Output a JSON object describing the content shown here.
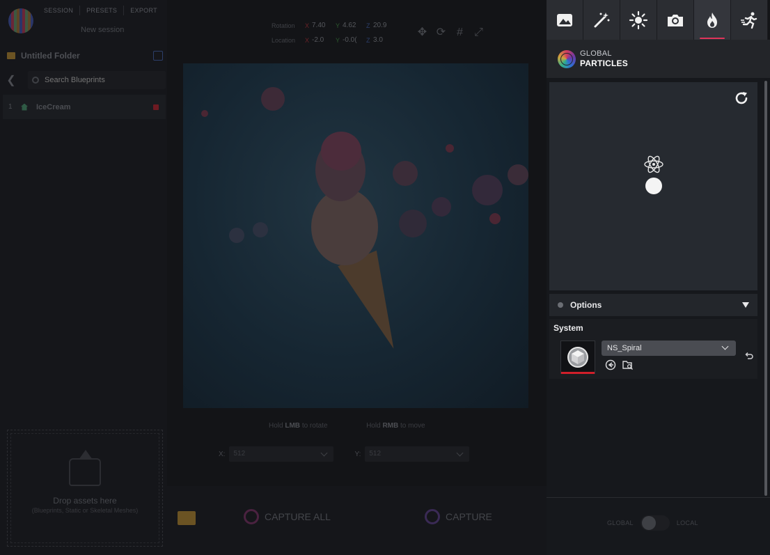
{
  "app": {
    "menu": [
      "SESSION",
      "PRESETS",
      "EXPORT"
    ],
    "session_name": "New session"
  },
  "sidebar": {
    "folder_title": "Untitled Folder",
    "search_placeholder": "Search Blueprints",
    "items": [
      {
        "index": "1",
        "name": "IceCream"
      }
    ],
    "drop_zone": {
      "title": "Drop assets here",
      "subtitle": "(Blueprints, Static or Skeletal Meshes)"
    }
  },
  "viewport": {
    "rotation_label": "Rotation",
    "location_label": "Location",
    "rotation": {
      "x": "7.40",
      "y": "4.62",
      "z": "20.9"
    },
    "location": {
      "x": "-2.0",
      "y": "-0.0(",
      "z": "3.0"
    },
    "axis_labels": {
      "x": "X",
      "y": "Y",
      "z": "Z"
    },
    "hint": {
      "lmb_prefix": "Hold",
      "lmb_key": "LMB",
      "lmb_suffix": "to rotate",
      "rmb_prefix": "Hold",
      "rmb_key": "RMB",
      "rmb_suffix": "to move"
    },
    "resolution": {
      "x_label": "X:",
      "x_value": "512",
      "y_label": "Y:",
      "y_value": "512"
    }
  },
  "bottom_bar": {
    "capture_all_label": "CAPTURE ALL",
    "capture_label": "CAPTURE"
  },
  "right_panel": {
    "tabs": [
      {
        "icon": "image-icon"
      },
      {
        "icon": "magic-wand-icon"
      },
      {
        "icon": "sun-icon"
      },
      {
        "icon": "camera-icon"
      },
      {
        "icon": "flame-icon",
        "active": true
      },
      {
        "icon": "running-person-icon"
      }
    ],
    "header": {
      "scope": "GLOBAL",
      "title": "PARTICLES"
    },
    "options": {
      "title": "Options",
      "system_label": "System",
      "system_value": "NS_Spiral"
    },
    "toggle": {
      "left": "GLOBAL",
      "right": "LOCAL"
    }
  },
  "colors": {
    "accent": "#e0345a",
    "asset_underline": "#d01f2a"
  }
}
